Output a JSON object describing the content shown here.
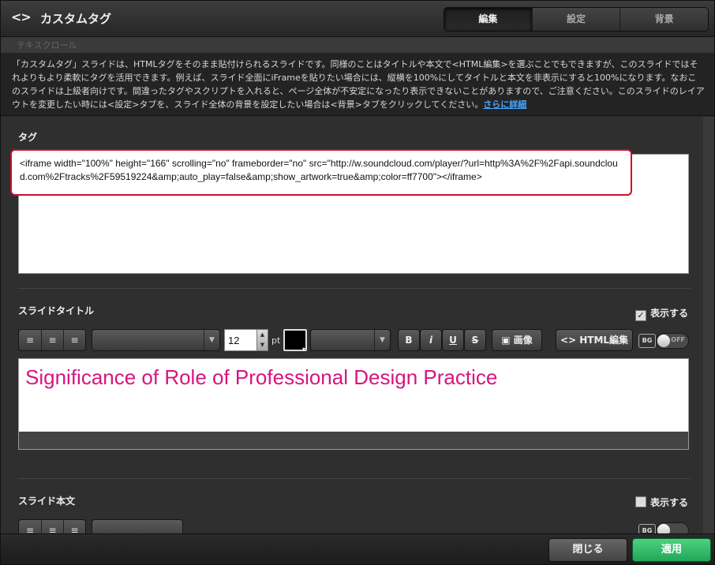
{
  "titlebar": {
    "icon": "<>",
    "title": "カスタムタグ"
  },
  "tabs": [
    "編集",
    "設定",
    "背景"
  ],
  "ghost_text": "テキスクロール",
  "description": {
    "text": "「カスタムタグ」スライドは、HTMLタグをそのまま貼付けられるスライドです。同様のことはタイトルや本文で<HTML編集>を選ぶことでもできますが、このスライドではそれよりもより柔軟にタグを活用できます。例えば、スライド全面にiFrameを貼りたい場合には、縦横を100%にしてタイトルと本文を非表示にすると100%になります。なおこのスライドは上級者向けです。間違ったタグやスクリプトを入れると、ページ全体が不安定になったり表示できないことがありますので、ご注意ください。このスライドのレイアウトを変更したい時には<設定>タブを、スライド全体の背景を設定したい場合は<背景>タブをクリックしてください。",
    "link": "さらに詳細"
  },
  "tag_section": {
    "label": "タグ",
    "value": "<iframe width=\"100%\" height=\"166\" scrolling=\"no\" frameborder=\"no\" src=\"http://w.soundcloud.com/player/?url=http%3A%2F%2Fapi.soundcloud.com%2Ftracks%2F59519224&amp;auto_play=false&amp;show_artwork=true&amp;color=ff7700\"></iframe>"
  },
  "slide_title": {
    "label": "スライドタイトル",
    "show_label": "表示する",
    "show_checked": true,
    "font_size": "12",
    "unit": "pt",
    "text_color": "#000000",
    "bold": "B",
    "italic": "i",
    "underline": "U",
    "strike": "S",
    "image_label": "画像",
    "html_edit_label": "HTML編集",
    "bg_label": "BG",
    "toggle_label": "OFF",
    "value": "Significance of Role of Professional Design Practice",
    "value_color": "#d6157f"
  },
  "slide_body": {
    "label": "スライド本文",
    "show_label": "表示する",
    "show_checked": false,
    "bg_label": "BG"
  },
  "footer": {
    "close_label": "閉じる",
    "apply_label": "適用"
  }
}
